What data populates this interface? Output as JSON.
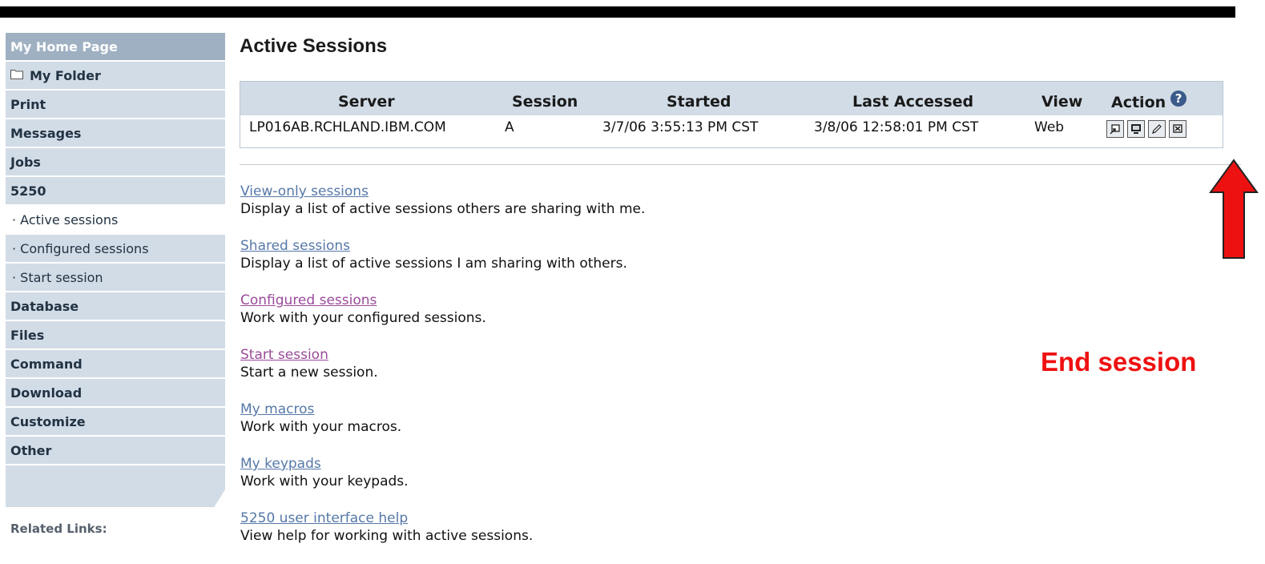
{
  "sidebar": {
    "home": "My Home Page",
    "folder": "My Folder",
    "items": [
      "Print",
      "Messages",
      "Jobs",
      "5250"
    ],
    "sub_items": [
      "· Active sessions",
      "· Configured sessions",
      "· Start session"
    ],
    "items2": [
      "Database",
      "Files",
      "Command",
      "Download",
      "Customize",
      "Other"
    ],
    "related_links": "Related Links:"
  },
  "main": {
    "title": "Active Sessions",
    "table": {
      "headers": [
        "Server",
        "Session",
        "Started",
        "Last Accessed",
        "View",
        "Action"
      ],
      "row": {
        "server": "LP016AB.RCHLAND.IBM.COM",
        "session": "A",
        "started": "3/7/06 3:55:13 PM CST",
        "last_accessed": "3/8/06 12:58:01 PM CST",
        "view": "Web"
      },
      "help_glyph": "?"
    },
    "links": [
      {
        "label": "View-only sessions",
        "desc": "Display a list of active sessions others are sharing with me."
      },
      {
        "label": "Shared sessions",
        "desc": "Display a list of active sessions I am sharing with others."
      },
      {
        "label": "Configured sessions",
        "desc": "Work with your configured sessions."
      },
      {
        "label": "Start session",
        "desc": "Start a new session."
      },
      {
        "label": "My macros",
        "desc": "Work with your macros."
      },
      {
        "label": "My keypads",
        "desc": "Work with your keypads."
      },
      {
        "label": "5250 user interface help",
        "desc": "View help for working with active sessions."
      }
    ]
  },
  "annotation": {
    "label": "End session",
    "color": "#ee1111"
  },
  "colors": {
    "nav_bg": "#d2dce6",
    "nav_home_bg": "#9fb0c2",
    "link": "#5578a8",
    "visited_link": "#9a4a9a"
  }
}
